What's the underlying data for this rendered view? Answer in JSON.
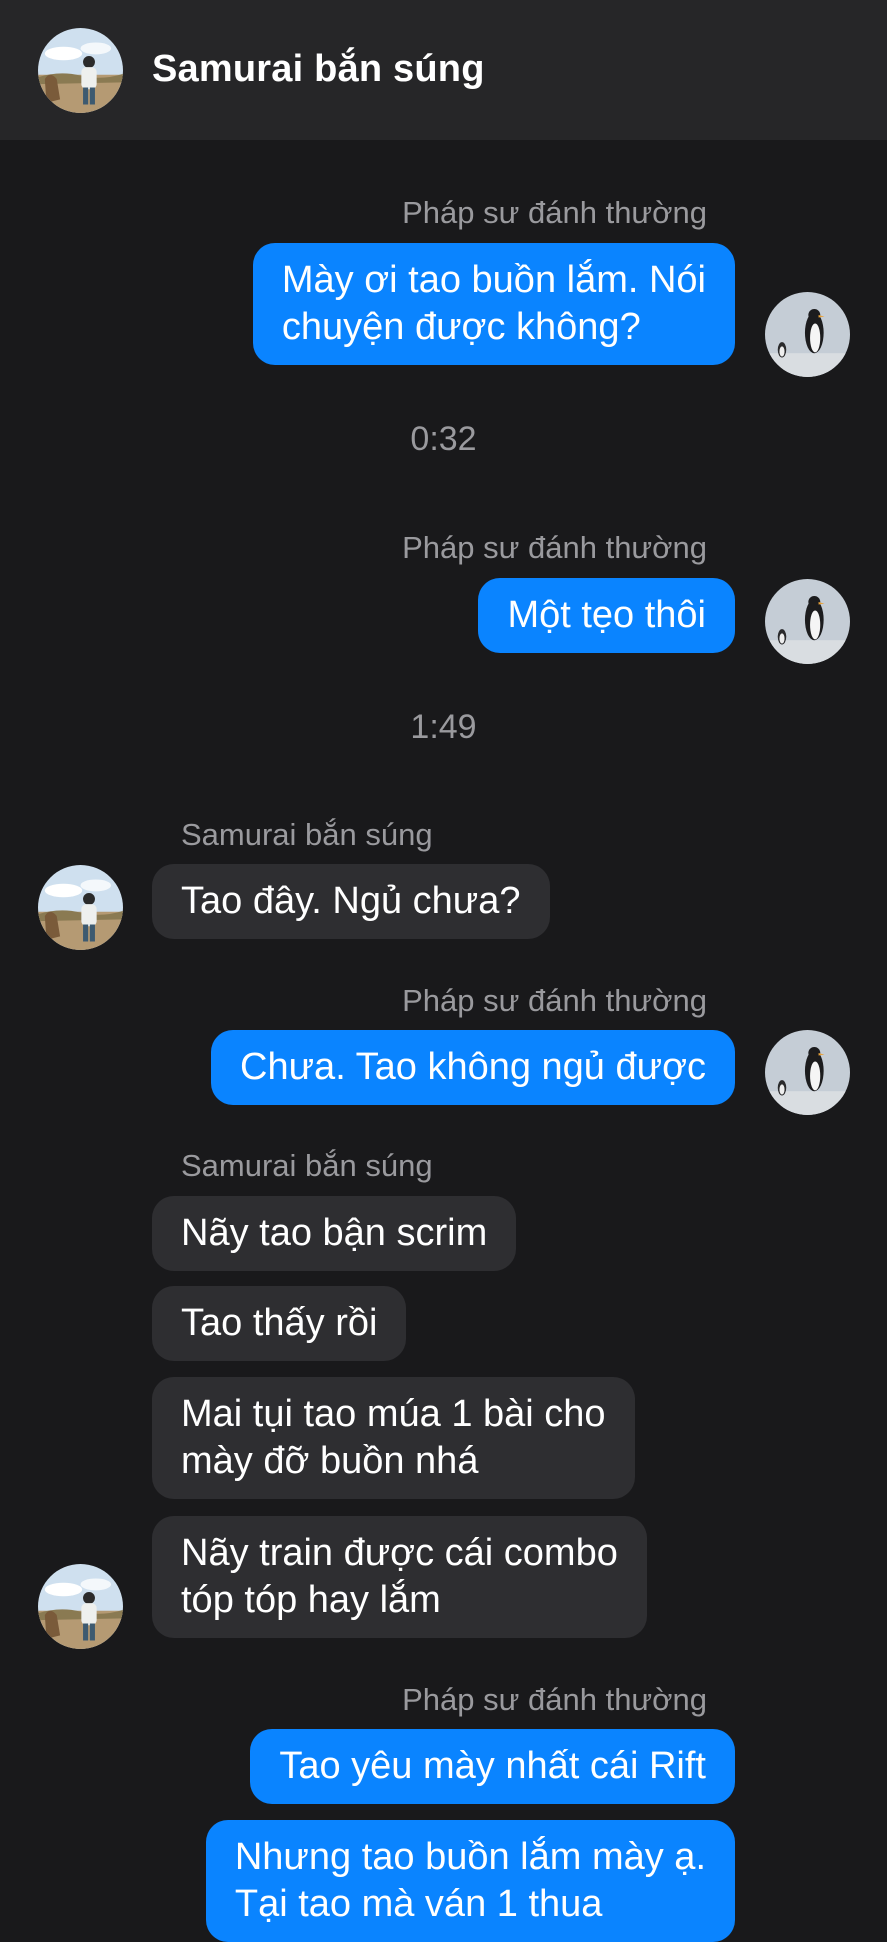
{
  "header": {
    "title": "Samurai bắn súng",
    "avatar_icon": "person-landscape-avatar-icon"
  },
  "colors": {
    "background": "#19191b",
    "header_background": "#262628",
    "outgoing_bubble": "#0a84ff",
    "incoming_bubble": "#2e2e31",
    "secondary_text": "#9a9a9e"
  },
  "participants": {
    "me": {
      "name": "Pháp sư đánh thường",
      "avatar_icon": "penguin-avatar-icon"
    },
    "them": {
      "name": "Samurai bắn súng",
      "avatar_icon": "person-landscape-avatar-icon"
    }
  },
  "conversation": {
    "sender_1": "Pháp sư đánh thường",
    "msg_1": "Mày ơi tao buồn lắm. Nói\nchuyện được không?",
    "time_1": "0:32",
    "sender_2": "Pháp sư đánh thường",
    "msg_2": "Một tẹo thôi",
    "time_2": "1:49",
    "sender_3": "Samurai bắn súng",
    "msg_3": "Tao đây. Ngủ chưa?",
    "sender_4": "Pháp sư đánh thường",
    "msg_4": "Chưa. Tao không ngủ được",
    "sender_5": "Samurai bắn súng",
    "msg_5a": "Nãy tao bận scrim",
    "msg_5b": "Tao thấy rồi",
    "msg_5c": "Mai tụi tao múa 1 bài cho\nmày đỡ buồn nhá",
    "msg_5d": "Nãy train được cái combo\ntóp tóp hay lắm",
    "sender_6": "Pháp sư đánh thường",
    "msg_6a": "Tao yêu mày nhất cái Rift",
    "msg_6b": "Nhưng tao buồn lắm mày ạ.\nTại tao mà ván 1 thua"
  }
}
